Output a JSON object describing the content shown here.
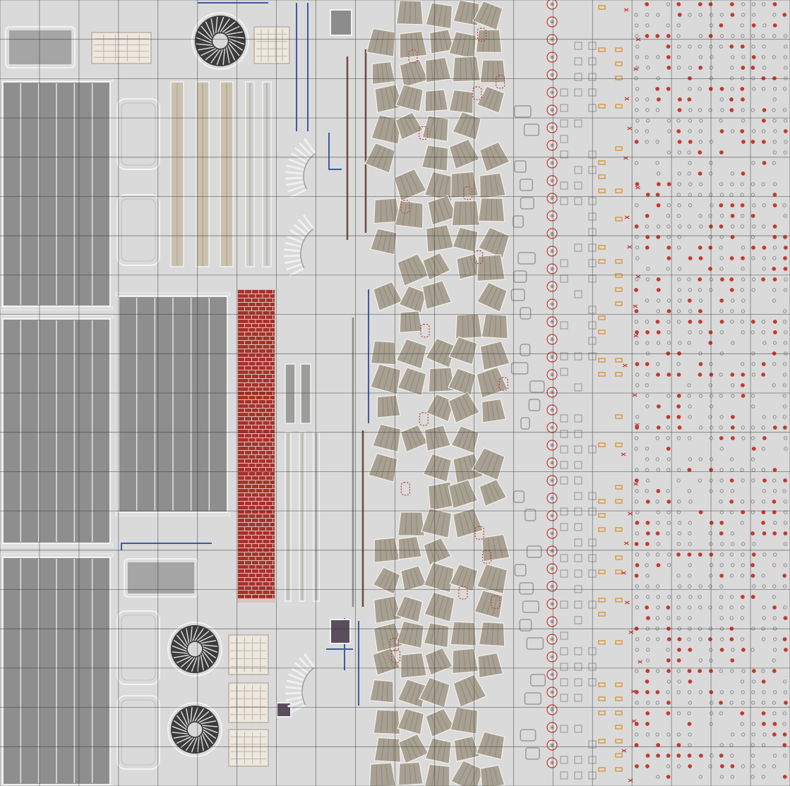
{
  "atlas": {
    "label": "",
    "colors": {
      "background": "#dadada",
      "grid_line": "#2a2a2a",
      "concrete": "#8e8e8e",
      "concrete_dark": "#7a7a7a",
      "panel_outline": "#f2f2f2",
      "stone_tile": "#a8a193",
      "stone_tile_dark": "#8f8878",
      "red_accent": "#c23a30",
      "brick_red": "#a8312a",
      "blue_line": "#3d5aa0",
      "orange_label": "#d9902c",
      "vent_dark": "#3c3c3c",
      "purple_block": "#5a4e5e"
    },
    "icons": {
      "fan_vent": "fan-vent-icon",
      "grate": "grate-icon",
      "stone_tile": "stone-tile-icon",
      "bolt": "bolt-icon",
      "brick_wall": "brick-wall-icon"
    }
  }
}
